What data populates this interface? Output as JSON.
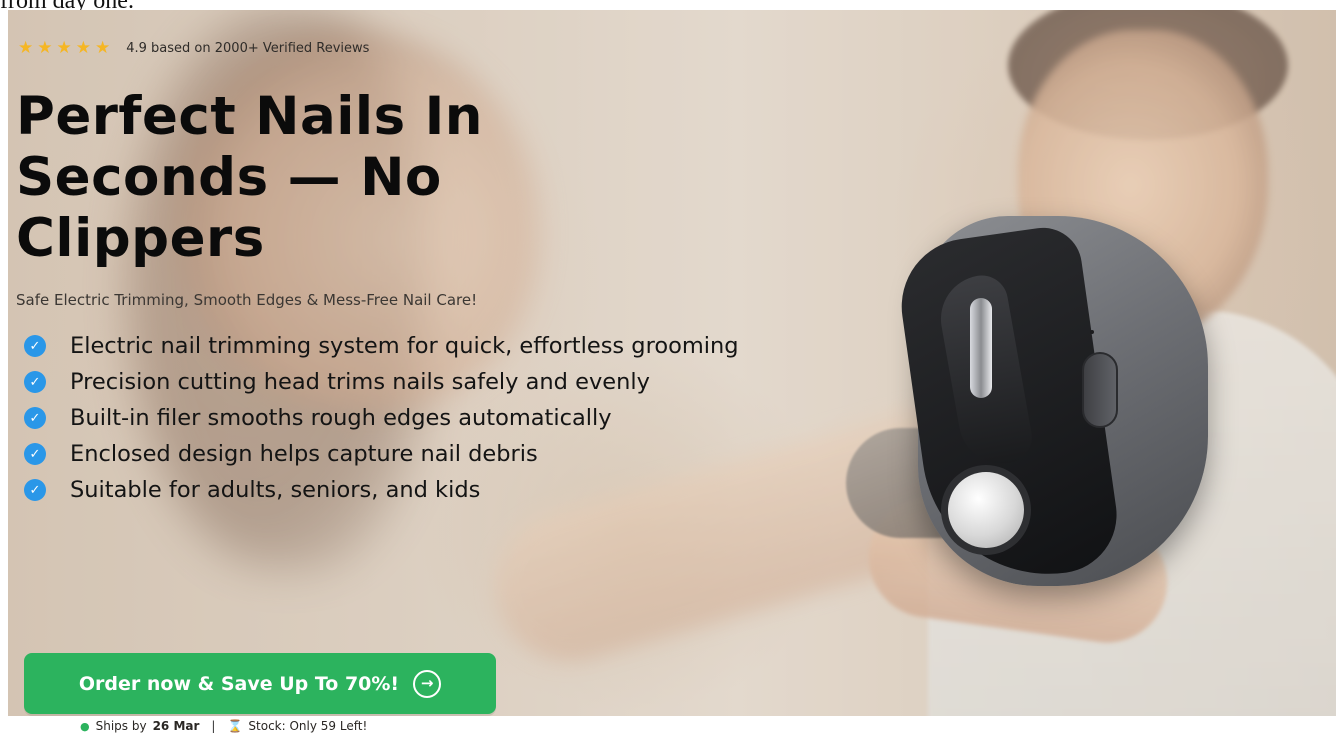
{
  "top_text": "from day one.",
  "rating": {
    "stars": 5,
    "text": "4.9 based on 2000+ Verified Reviews"
  },
  "headline": "Perfect Nails In Seconds — No Clippers",
  "subheadline": "Safe Electric Trimming, Smooth Edges & Mess-Free Nail Care!",
  "features": [
    "Electric nail trimming system for quick, effortless grooming",
    "Precision cutting head trims nails safely and evenly",
    "Built-in filer smooths rough edges automatically",
    "Enclosed design helps capture nail debris",
    "Suitable for adults, seniors, and kids"
  ],
  "cta": {
    "label": "Order now & Save Up To 70%!",
    "icon": "arrow-right-icon"
  },
  "shipping": {
    "ships_prefix": "Ships by",
    "ships_date": "26 Mar",
    "separator": "|",
    "stock_text": "Stock: Only 59 Left!"
  },
  "colors": {
    "star": "#f5b624",
    "check": "#2a97e8",
    "cta_bg": "#2cb35e",
    "headline": "#0b0b0b"
  }
}
